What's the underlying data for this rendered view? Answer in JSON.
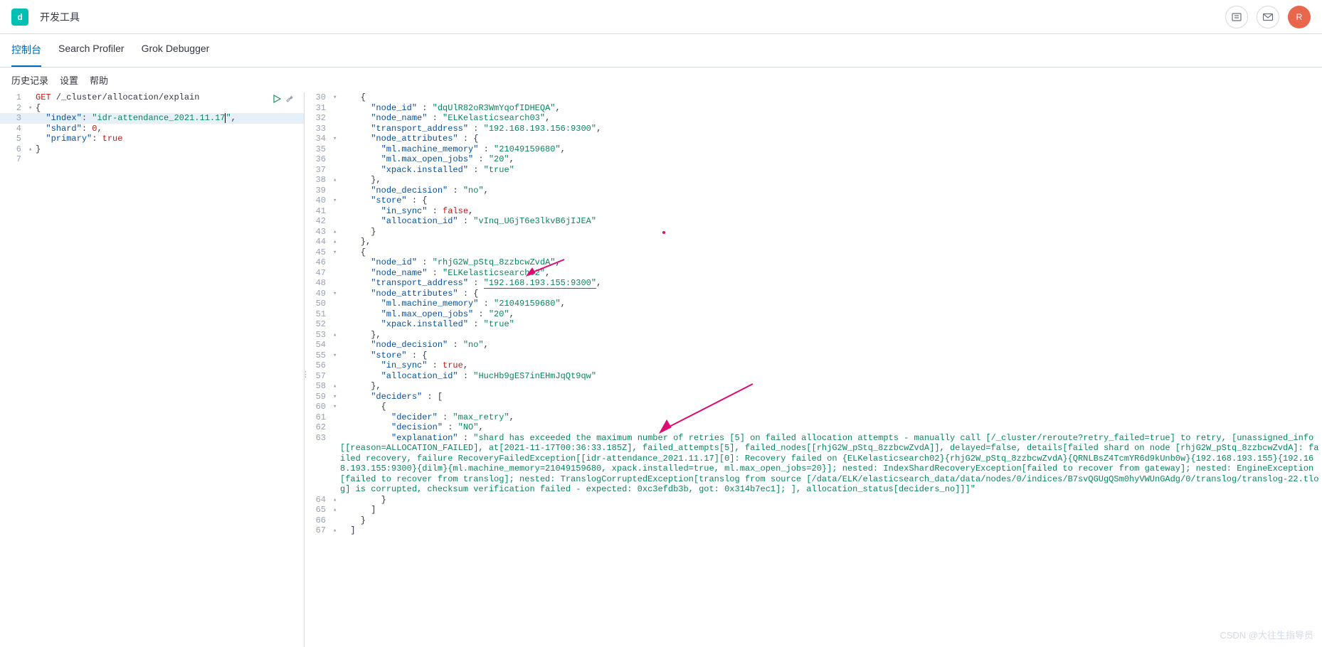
{
  "header": {
    "logo_letter": "d",
    "title": "开发工具",
    "avatar_letter": "R"
  },
  "tabs": [
    "控制台",
    "Search Profiler",
    "Grok Debugger"
  ],
  "subnav": [
    "历史记录",
    "设置",
    "帮助"
  ],
  "request": {
    "lines": [
      {
        "n": "1",
        "fold": "",
        "html": "<span class='kw'>GET</span> /_cluster/allocation/explain"
      },
      {
        "n": "2",
        "fold": "▾",
        "html": "{"
      },
      {
        "n": "3",
        "fold": "",
        "html": "  <span class='key'>\"index\"</span>: <span class='str'>\"idr-attendance_2021.11.17<span class='cursor'></span>\"</span>,",
        "hl": true
      },
      {
        "n": "4",
        "fold": "",
        "html": "  <span class='key'>\"shard\"</span>: <span class='num'>0</span>,"
      },
      {
        "n": "5",
        "fold": "",
        "html": "  <span class='key'>\"primary\"</span>: <span class='bool'>true</span>"
      },
      {
        "n": "6",
        "fold": "▴",
        "html": "}"
      },
      {
        "n": "7",
        "fold": "",
        "html": ""
      }
    ]
  },
  "response": {
    "lines": [
      {
        "n": "30",
        "fold": "▾",
        "html": "    {"
      },
      {
        "n": "31",
        "fold": "",
        "html": "      <span class='key'>\"node_id\"</span> : <span class='str'>\"dqUlR82oR3WmYqofIDHEQA\"</span>,"
      },
      {
        "n": "32",
        "fold": "",
        "html": "      <span class='key'>\"node_name\"</span> : <span class='str'>\"ELKelasticsearch03\"</span>,"
      },
      {
        "n": "33",
        "fold": "",
        "html": "      <span class='key'>\"transport_address\"</span> : <span class='str'>\"192.168.193.156:9300\"</span>,"
      },
      {
        "n": "34",
        "fold": "▾",
        "html": "      <span class='key'>\"node_attributes\"</span> : {"
      },
      {
        "n": "35",
        "fold": "",
        "html": "        <span class='key'>\"ml.machine_memory\"</span> : <span class='str'>\"21049159680\"</span>,"
      },
      {
        "n": "36",
        "fold": "",
        "html": "        <span class='key'>\"ml.max_open_jobs\"</span> : <span class='str'>\"20\"</span>,"
      },
      {
        "n": "37",
        "fold": "",
        "html": "        <span class='key'>\"xpack.installed\"</span> : <span class='str'>\"true\"</span>"
      },
      {
        "n": "38",
        "fold": "▴",
        "html": "      },"
      },
      {
        "n": "39",
        "fold": "",
        "html": "      <span class='key'>\"node_decision\"</span> : <span class='str'>\"no\"</span>,"
      },
      {
        "n": "40",
        "fold": "▾",
        "html": "      <span class='key'>\"store\"</span> : {"
      },
      {
        "n": "41",
        "fold": "",
        "html": "        <span class='key'>\"in_sync\"</span> : <span class='bool'>false</span>,"
      },
      {
        "n": "42",
        "fold": "",
        "html": "        <span class='key'>\"allocation_id\"</span> : <span class='str'>\"vInq_UGjT6e3lkvB6jIJEA\"</span>"
      },
      {
        "n": "43",
        "fold": "▴",
        "html": "      }"
      },
      {
        "n": "44",
        "fold": "▴",
        "html": "    },"
      },
      {
        "n": "45",
        "fold": "▾",
        "html": "    {"
      },
      {
        "n": "46",
        "fold": "",
        "html": "      <span class='key'>\"node_id\"</span> : <span class='str'>\"rhjG2W_pStq_8zzbcwZvdA\"</span>,"
      },
      {
        "n": "47",
        "fold": "",
        "html": "      <span class='key'>\"node_name\"</span> : <span class='str'>\"ELKelasticsearch02\"</span>,"
      },
      {
        "n": "48",
        "fold": "",
        "html": "      <span class='key'>\"transport_address\"</span> : <span class='str underline-red'>\"192.168.193.155:9300\"</span>,"
      },
      {
        "n": "49",
        "fold": "▾",
        "html": "      <span class='key'>\"node_attributes\"</span> : {"
      },
      {
        "n": "50",
        "fold": "",
        "html": "        <span class='key'>\"ml.machine_memory\"</span> : <span class='str'>\"21049159680\"</span>,"
      },
      {
        "n": "51",
        "fold": "",
        "html": "        <span class='key'>\"ml.max_open_jobs\"</span> : <span class='str'>\"20\"</span>,"
      },
      {
        "n": "52",
        "fold": "",
        "html": "        <span class='key'>\"xpack.installed\"</span> : <span class='str'>\"true\"</span>"
      },
      {
        "n": "53",
        "fold": "▴",
        "html": "      },"
      },
      {
        "n": "54",
        "fold": "",
        "html": "      <span class='key'>\"node_decision\"</span> : <span class='str'>\"no\"</span>,"
      },
      {
        "n": "55",
        "fold": "▾",
        "html": "      <span class='key'>\"store\"</span> : {"
      },
      {
        "n": "56",
        "fold": "",
        "html": "        <span class='key'>\"in_sync\"</span> : <span class='bool'>true</span>,"
      },
      {
        "n": "57",
        "fold": "",
        "html": "        <span class='key'>\"allocation_id\"</span> : <span class='str'>\"HucHb9gES7inEHmJqQt9qw\"</span>"
      },
      {
        "n": "58",
        "fold": "▴",
        "html": "      },"
      },
      {
        "n": "59",
        "fold": "▾",
        "html": "      <span class='key'>\"deciders\"</span> : ["
      },
      {
        "n": "60",
        "fold": "▾",
        "html": "        {"
      },
      {
        "n": "61",
        "fold": "",
        "html": "          <span class='key'>\"decider\"</span> : <span class='str'>\"max_retry\"</span>,"
      },
      {
        "n": "62",
        "fold": "",
        "html": "          <span class='key'>\"decision\"</span> : <span class='str'>\"NO\"</span>,"
      },
      {
        "n": "63",
        "fold": "",
        "html": "          <span class='key'>\"explanation\"</span> : <span class='str'>\"shard has exceeded the maximum number of retries [5] on failed allocation attempts - manually call [/_cluster/reroute?retry_failed=true] to retry, [unassigned_info[[reason=ALLOCATION_FAILED], at[2021-11-17T00:36:33.185Z], failed_attempts[5], failed_nodes[[rhjG2W_pStq_8zzbcwZvdA]], delayed=false, details[failed shard on node [rhjG2W_pStq_8zzbcwZvdA]: failed recovery, failure RecoveryFailedException[[idr-attendance_2021.11.17][0]: Recovery failed on {ELKelasticsearch02}{rhjG2W_pStq_8zzbcwZvdA}{QRNLBsZ4TcmYR6d9kUnb0w}{192.168.193.155}{192.168.193.155:9300}{dilm}{ml.machine_memory=21049159680, xpack.installed=true, ml.max_open_jobs=20}]; nested: IndexShardRecoveryException[failed to recover from gateway]; nested: EngineException[failed to recover from translog]; nested: TranslogCorruptedException[translog from source [/data/ELK/elasticsearch_data/data/nodes/0/indices/B7svQGUgQSm0hyVWUnGAdg/0/translog/translog-22.tlog] is corrupted, checksum verification failed - expected: 0xc3efdb3b, got: 0x314b7ec1]; ], allocation_status[deciders_no]]]\"</span>",
        "wrap": true
      },
      {
        "n": "64",
        "fold": "▴",
        "html": "        }"
      },
      {
        "n": "65",
        "fold": "▴",
        "html": "      ]"
      },
      {
        "n": "66",
        "fold": "",
        "html": "    }"
      },
      {
        "n": "67",
        "fold": "▴",
        "html": "  ]"
      }
    ]
  },
  "watermark": "CSDN @大往生指导员"
}
